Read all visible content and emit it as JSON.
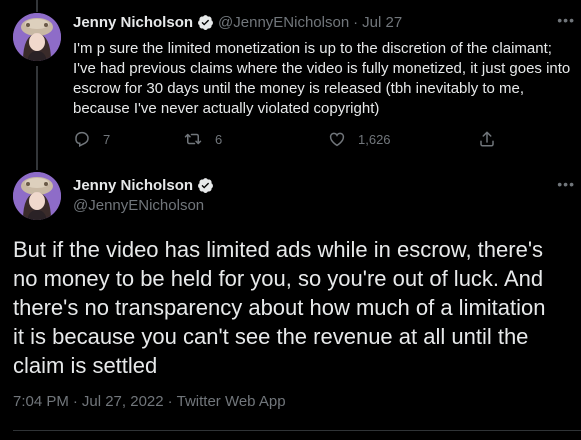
{
  "colors": {
    "background": "#000000",
    "text": "#e7e9ea",
    "secondary": "#71767b",
    "verified": "#1d9bf0"
  },
  "tweets": [
    {
      "name": "Jenny Nicholson",
      "handle": "@JennyENicholson",
      "date": "Jul 27",
      "lines": [
        "I'm p sure the limited monetization is up to the discretion of the claimant;",
        "I've had previous claims where the video is fully monetized, it just goes into",
        "escrow for 30 days until the money is released (tbh inevitably to me,",
        "because I've never actually violated copyright)"
      ],
      "stats": {
        "replies": "7",
        "retweets": "6",
        "likes": "1,626"
      }
    },
    {
      "name": "Jenny Nicholson",
      "handle": "@JennyENicholson",
      "lines": [
        "But if the video has limited ads while in escrow, there's",
        "no money to be held for you, so you're out of luck. And",
        "there's no transparency about how much of a limitation",
        "it is because you can't see the revenue at all until the",
        "claim is settled"
      ],
      "time": "7:04 PM",
      "full_date": "Jul 27, 2022",
      "source": "Twitter Web App"
    }
  ],
  "icons": {
    "verified": "verified-badge-icon",
    "more": "more-options-icon",
    "reply": "reply-icon",
    "retweet": "retweet-icon",
    "like": "like-icon",
    "share": "share-icon"
  }
}
